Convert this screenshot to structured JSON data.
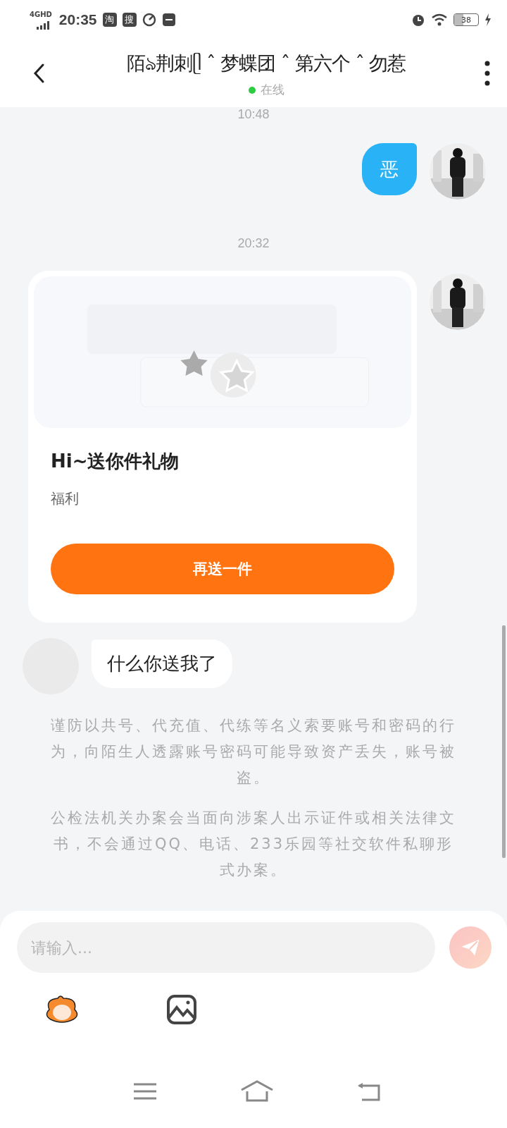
{
  "status_bar": {
    "network": "4GHD",
    "time": "20:35",
    "app_icons": [
      "淘",
      "搜"
    ],
    "battery": "38"
  },
  "header": {
    "title": "陌ঌ荆刺ᥫ ˆ 梦蝶团 ˆ 第六个 ˆ 勿惹",
    "status": "在线",
    "online": true
  },
  "messages": [
    {
      "kind": "time",
      "text": "10:48"
    },
    {
      "kind": "text",
      "outgoing": true,
      "text": "恶",
      "color": "#29b2f5"
    },
    {
      "kind": "time",
      "text": "20:32"
    },
    {
      "kind": "gift",
      "title": "Hi~送你件礼物",
      "subtitle": "福利",
      "button": "再送一件"
    },
    {
      "kind": "text",
      "outgoing": false,
      "text": "什么你送我了",
      "color": "#ffffff"
    },
    {
      "kind": "notice",
      "text": "谨防以共号、代充值、代练等名义索要账号和密码的行为，向陌生人透露账号密码可能导致资产丢失，账号被盗。"
    },
    {
      "kind": "notice",
      "text": "公检法机关办案会当面向涉案人出示证件或相关法律文书，不会通过QQ、电话、233乐园等社交软件私聊形式办案。"
    }
  ],
  "composer": {
    "placeholder": "请输入..."
  }
}
